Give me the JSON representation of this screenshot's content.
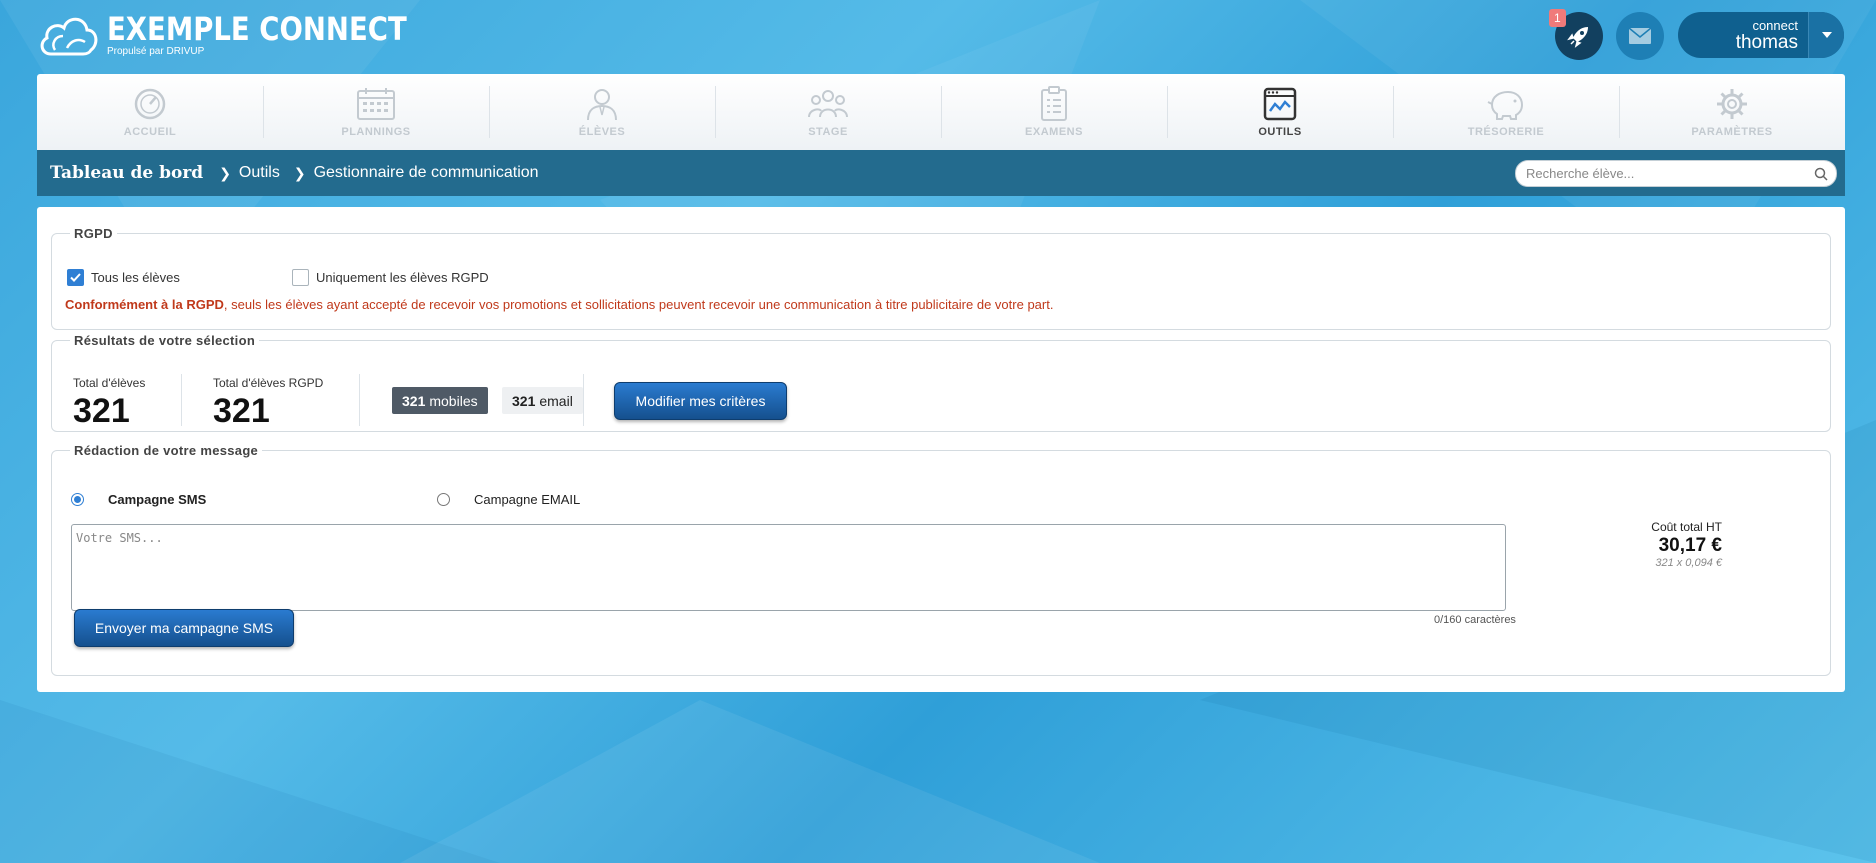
{
  "header": {
    "logo_title": "EXEMPLE CONNECT",
    "logo_subtitle": "Propulsé par DRIVUP",
    "notification_count": "1",
    "user_role": "connect",
    "user_name": "thomas"
  },
  "nav": {
    "items": [
      {
        "label": "ACCUEIL",
        "icon": "dashboard-icon",
        "active": false
      },
      {
        "label": "PLANNINGS",
        "icon": "calendar-icon",
        "active": false
      },
      {
        "label": "ÉLÈVES",
        "icon": "student-icon",
        "active": false
      },
      {
        "label": "STAGE",
        "icon": "group-icon",
        "active": false
      },
      {
        "label": "EXAMENS",
        "icon": "clipboard-icon",
        "active": false
      },
      {
        "label": "OUTILS",
        "icon": "tools-window-icon",
        "active": true
      },
      {
        "label": "TRÉSORERIE",
        "icon": "piggy-bank-icon",
        "active": false
      },
      {
        "label": "PARAMÈTRES",
        "icon": "gear-icon",
        "active": false
      }
    ]
  },
  "breadcrumb": {
    "root": "Tableau de bord",
    "level1": "Outils",
    "level2": "Gestionnaire de communication"
  },
  "search": {
    "placeholder": "Recherche élève..."
  },
  "rgpd": {
    "legend": "RGPD",
    "option_all": "Tous les élèves",
    "option_all_checked": true,
    "option_rgpd": "Uniquement les élèves RGPD",
    "option_rgpd_checked": false,
    "note_bold": "Conformément à la RGPD",
    "note_rest": ", seuls les élèves ayant accepté de recevoir vos promotions et sollicitations peuvent recevoir une communication à titre publicitaire de votre part."
  },
  "results": {
    "legend": "Résultats de votre sélection",
    "total_label": "Total d'élèves",
    "total_value": "321",
    "total_rgpd_label": "Total d'élèves RGPD",
    "total_rgpd_value": "321",
    "mobiles_count": "321",
    "mobiles_label": "mobiles",
    "email_count": "321",
    "email_label": "email",
    "modify_button": "Modifier mes critères"
  },
  "message": {
    "legend": "Rédaction de votre message",
    "sms_option": "Campagne SMS",
    "sms_selected": true,
    "email_option": "Campagne EMAIL",
    "email_selected": false,
    "sms_value": "",
    "sms_placeholder": "Votre SMS...",
    "char_count": "0/160 caractères",
    "send_button": "Envoyer ma campagne SMS",
    "cost_label": "Coût total HT",
    "cost_value": "30,17 €",
    "cost_detail": "321 x 0,094 €"
  },
  "colors": {
    "background": "#3aa6dc",
    "breadcrumb_bar": "#236b8e",
    "accent_blue": "#2f7fd4",
    "warning_red": "#c0391b"
  }
}
